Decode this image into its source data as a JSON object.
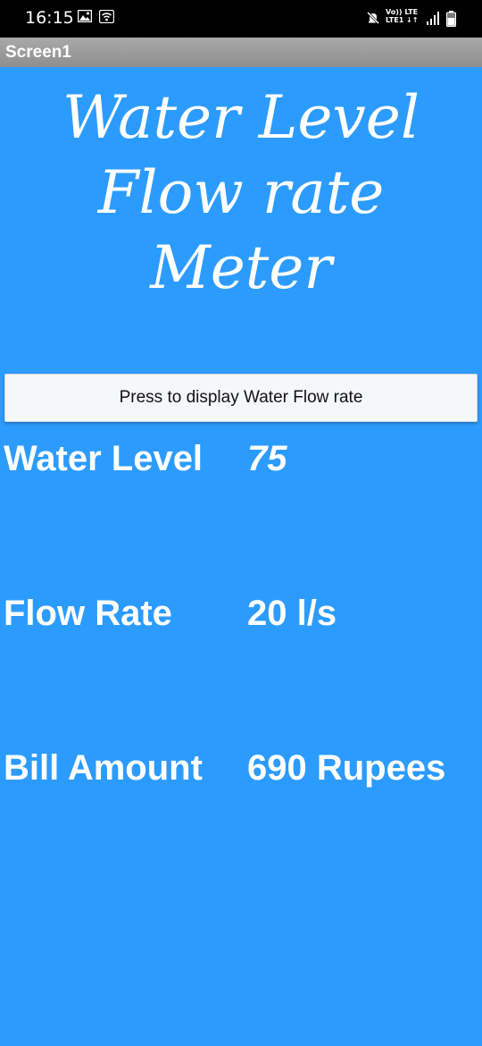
{
  "status_bar": {
    "time": "16:15",
    "left_icons": [
      "image-icon",
      "wifi-icon"
    ],
    "right_icons": [
      "mute-icon",
      "volte-lte-icon",
      "signal-icon",
      "battery-icon"
    ],
    "net_top": "Vo)) LTE",
    "net_bottom": "LTE1 ↓↑"
  },
  "title_bar": {
    "label": "Screen1"
  },
  "app": {
    "title_line1": "Water Level",
    "title_line2": "Flow rate",
    "title_line3": "Meter"
  },
  "action_button": {
    "label": "Press to display Water Flow rate"
  },
  "readings": {
    "water_level": {
      "label": "Water Level",
      "value": "75"
    },
    "flow_rate": {
      "label": "Flow Rate",
      "value": "20 l/s"
    },
    "bill_amount": {
      "label": "Bill Amount",
      "value": "690 Rupees"
    }
  },
  "colors": {
    "background": "#2C9BFE",
    "title_bar": "#9B9B9B",
    "button": "#F5F7FA",
    "text": "#FFFFFF"
  }
}
